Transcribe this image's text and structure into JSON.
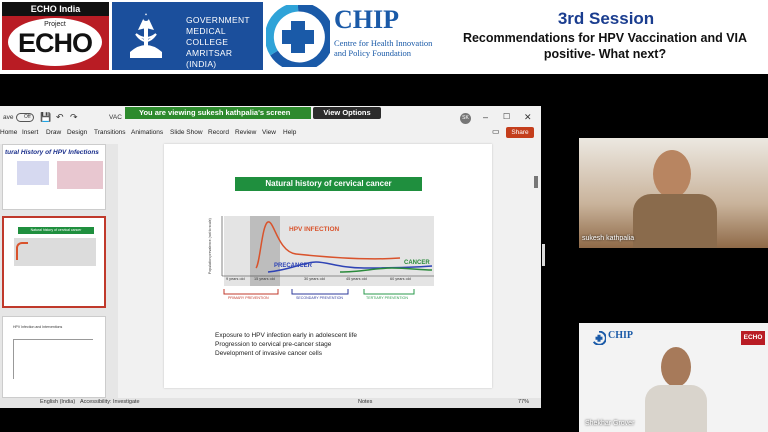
{
  "banner": {
    "echo_header": "ECHO India",
    "echo_project": "Project",
    "echo_word": "ECHO",
    "gmc_lines": [
      "GOVERNMENT",
      "MEDICAL COLLEGE",
      "AMRITSAR (INDIA)"
    ],
    "chip_word": "CHIP",
    "chip_sub_lines": [
      "Centre for Health Innovation",
      "and Policy Foundation"
    ],
    "session_title": "3rd Session",
    "session_sub_lines": [
      "Recommendations for HPV Vaccination and VIA",
      "positive- What next?"
    ]
  },
  "share_bar": {
    "viewing_text": "You are viewing  sukesh kathpalia's screen",
    "view_options": "View Options"
  },
  "ppt": {
    "autosave": "ave",
    "autosave_state": "Off",
    "file_name": "VAC",
    "user_initials": "SK",
    "menu": [
      "Home",
      "Insert",
      "Draw",
      "Design",
      "Transitions",
      "Animations",
      "Slide Show",
      "Record",
      "Review",
      "View",
      "Help"
    ],
    "share": "Share",
    "thumb1_title": "tural History of HPV Infections",
    "thumb2_title": "Natural history of cervical cancer",
    "thumb3_title": "HPV Infection and Interventions",
    "status_lang": "English (India)",
    "status_access": "Accessibility: Investigate",
    "status_notes": "Notes",
    "status_zoom": "77%"
  },
  "slide": {
    "title": "Natural history of cervical cancer",
    "y_axis": "Population prevalence (not to scale)",
    "hpv_label": "HPV INFECTION",
    "precancer_label": "PRECANCER",
    "cancer_label": "CANCER",
    "ages": [
      "9 years old",
      "15 years old",
      "30 years old",
      "45 years old",
      "60 years old"
    ],
    "phases": [
      "PRIMARY PREVENTION",
      "SECONDARY PREVENTION",
      "TERTIARY PREVENTION"
    ],
    "bullets": [
      "Exposure to HPV infection early in adolescent life",
      "Progression to cervical pre-cancer stage",
      "Development of invasive cancer cells"
    ]
  },
  "videos": {
    "participant1": "sukesh kathpalia",
    "participant2": "Shekhar Grover",
    "chip_word": "CHIP",
    "echo_word": "ECHO"
  },
  "colors": {
    "hpv": "#d9532c",
    "precancer": "#2e43b5",
    "cancer": "#2a8a3b",
    "primary": "#c0392b",
    "secondary": "#2e3a9b",
    "tertiary": "#2a9a4b"
  }
}
